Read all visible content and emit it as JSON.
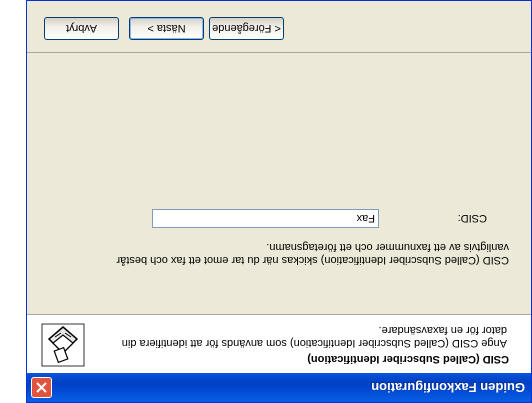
{
  "window": {
    "title": "Guiden Faxkonfiguration"
  },
  "header": {
    "title": "CSID (Called Subscriber Identification)",
    "description": "Ange CSID (Called Subscriber Identification) som används för att identifiera din dator för en faxavsändare.",
    "icon": "fax-wizard-icon"
  },
  "body": {
    "description": "CSID (Called Subscriber Identification) skickas när du tar emot ett fax och består vanligtvis av ett faxnummer och ett företagsnamn.",
    "csid_label": "CSID:",
    "csid_value": "Fax"
  },
  "footer": {
    "back_label": "< Föregående",
    "next_label": "Nästa >",
    "cancel_label": "Avbryt"
  },
  "colors": {
    "titlebar": "#0054e3",
    "close": "#e0543d",
    "window_bg": "#ece9d8"
  }
}
